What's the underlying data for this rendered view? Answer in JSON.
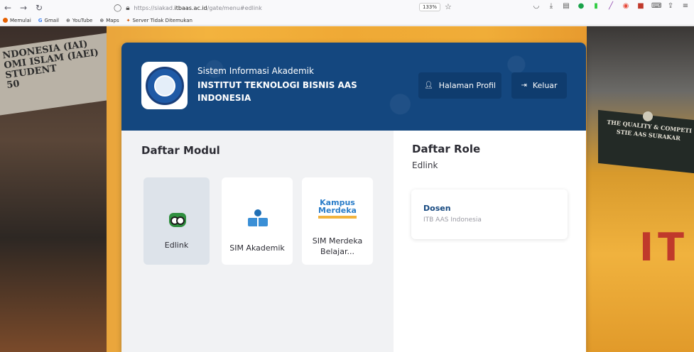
{
  "browser": {
    "url_prefix": "https://siakad.",
    "url_domain": "itbaas.ac.id",
    "url_path": "/gate/menu#edlink",
    "zoom": "133%",
    "bookmarks": [
      {
        "label": "Memulai",
        "icon": "firefox-icon",
        "color": "#e66000"
      },
      {
        "label": "Gmail",
        "icon": "google-icon",
        "color": "#4285f4"
      },
      {
        "label": "YouTube",
        "icon": "globe-icon",
        "color": "#555555"
      },
      {
        "label": "Maps",
        "icon": "globe-icon",
        "color": "#555555"
      },
      {
        "label": "Server Tidak Ditemukan",
        "icon": "warning-icon",
        "color": "#d35400"
      }
    ]
  },
  "background": {
    "banner_left": "NDONESIA (IAI)\nOMI ISLAM (IAEI)\nSTUDENT\n50",
    "banner_right": "THE QUALITY & COMPETI\nSTIE AAS SURAKAR",
    "letters_right": "IT"
  },
  "header": {
    "subtitle": "Sistem Informasi Akademik",
    "title": "INSTITUT TEKNOLOGI BISNIS AAS INDONESIA",
    "profile_button": "Halaman Profil",
    "logout_button": "Keluar"
  },
  "modules": {
    "title": "Daftar Modul",
    "items": [
      {
        "label": "Edlink",
        "icon": "owl-icon",
        "active": true
      },
      {
        "label": "SIM Akademik",
        "icon": "reader-icon",
        "active": false
      },
      {
        "label": "SIM Merdeka Belajar...",
        "icon": "kampus-merdeka-logo",
        "active": false
      }
    ],
    "kampus_logo_line1": "Kampus",
    "kampus_logo_line2": "Merdeka"
  },
  "roles": {
    "title": "Daftar Role",
    "subtitle": "Edlink",
    "items": [
      {
        "name": "Dosen",
        "org": "ITB AAS Indonesia"
      }
    ]
  },
  "colors": {
    "header_blue": "#14477f",
    "button_blue": "#0f3c6e",
    "modules_bg": "#f1f2f4",
    "active_module_bg": "#dde3ea"
  }
}
